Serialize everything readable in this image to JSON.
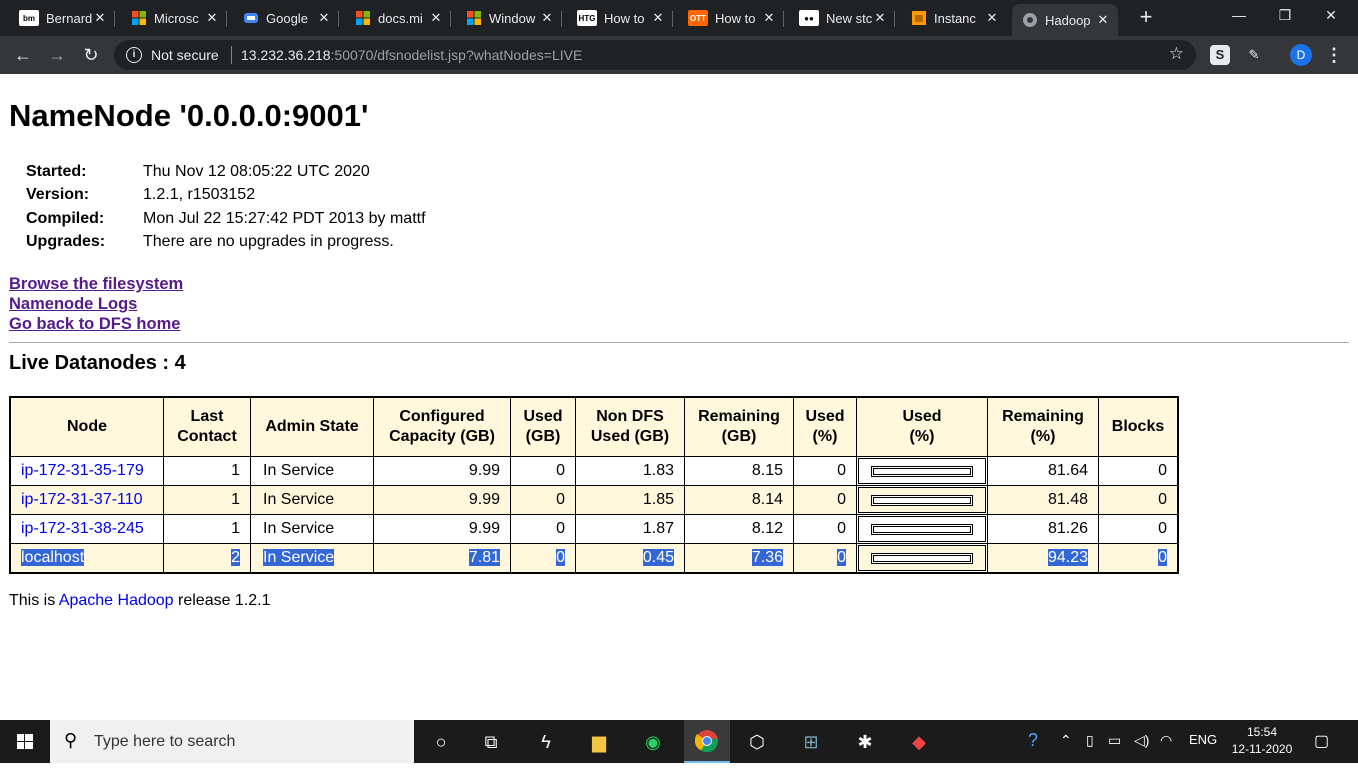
{
  "browser": {
    "tabs": [
      {
        "title": "Bernard",
        "icon": "bm-icon",
        "fav_text": "bm",
        "fav_color": "#ffffff"
      },
      {
        "title": "Microsc",
        "icon": "microsoft-icon",
        "fav_text": "",
        "fav_color": "#f25022"
      },
      {
        "title": "Google",
        "icon": "google-cloud-icon",
        "fav_text": "",
        "fav_color": "#4285f4"
      },
      {
        "title": "docs.mi",
        "icon": "microsoft-icon",
        "fav_text": "",
        "fav_color": "#f25022"
      },
      {
        "title": "Window",
        "icon": "microsoft-icon",
        "fav_text": "",
        "fav_color": "#f25022"
      },
      {
        "title": "How to",
        "icon": "htg-icon",
        "fav_text": "HTG",
        "fav_color": "#000000"
      },
      {
        "title": "How to",
        "icon": "ott-icon",
        "fav_text": "OTT",
        "fav_color": "#ff6600"
      },
      {
        "title": "New stc",
        "icon": "medium-icon",
        "fav_text": "●●",
        "fav_color": "#000000"
      },
      {
        "title": "Instanc",
        "icon": "aws-icon",
        "fav_text": "",
        "fav_color": "#f90"
      },
      {
        "title": "Hadoop",
        "icon": "globe-icon",
        "fav_text": "",
        "fav_color": "#9aa0a6"
      }
    ],
    "new_tab": "+",
    "window_controls": {
      "minimize": "—",
      "restore": "❐",
      "close": "✕"
    },
    "address": {
      "secure_label": "Not secure",
      "host": "13.232.36.218",
      "rest": ":50070/dfsnodelist.jsp?whatNodes=LIVE"
    },
    "profile_initial": "D"
  },
  "page": {
    "title": "NameNode '0.0.0.0:9001'",
    "info": [
      {
        "key": "Started:",
        "value": "Thu Nov 12 08:05:22 UTC 2020"
      },
      {
        "key": "Version:",
        "value": "1.2.1, r1503152"
      },
      {
        "key": "Compiled:",
        "value": "Mon Jul 22 15:27:42 PDT 2013 by mattf"
      },
      {
        "key": "Upgrades:",
        "value": "There are no upgrades in progress."
      }
    ],
    "links": [
      "Browse the filesystem",
      "Namenode Logs",
      "Go back to DFS home"
    ],
    "live_heading": "Live Datanodes : 4",
    "table": {
      "headers": [
        "Node",
        "Last Contact",
        "Admin State",
        "Configured Capacity (GB)",
        "Used (GB)",
        "Non DFS Used (GB)",
        "Remaining (GB)",
        "Used (%)",
        "Used (%)",
        "Remaining (%)",
        "Blocks"
      ],
      "rows": [
        {
          "node": "ip-172-31-35-179",
          "last_contact": "1",
          "admin_state": "In Service",
          "capacity": "9.99",
          "used": "0",
          "non_dfs": "1.83",
          "remaining": "8.15",
          "used_pct": "0",
          "used_bar_fraction": 0,
          "remaining_pct": "81.64",
          "blocks": "0"
        },
        {
          "node": "ip-172-31-37-110",
          "last_contact": "1",
          "admin_state": "In Service",
          "capacity": "9.99",
          "used": "0",
          "non_dfs": "1.85",
          "remaining": "8.14",
          "used_pct": "0",
          "used_bar_fraction": 0,
          "remaining_pct": "81.48",
          "blocks": "0"
        },
        {
          "node": "ip-172-31-38-245",
          "last_contact": "1",
          "admin_state": "In Service",
          "capacity": "9.99",
          "used": "0",
          "non_dfs": "1.87",
          "remaining": "8.12",
          "used_pct": "0",
          "used_bar_fraction": 0,
          "remaining_pct": "81.26",
          "blocks": "0"
        },
        {
          "node": "localhost",
          "last_contact": "2",
          "admin_state": "In Service",
          "capacity": "7.81",
          "used": "0",
          "non_dfs": "0.45",
          "remaining": "7.36",
          "used_pct": "0",
          "used_bar_fraction": 0,
          "remaining_pct": "94.23",
          "blocks": "0"
        }
      ]
    },
    "footer": {
      "prefix": "This is ",
      "link": "Apache Hadoop",
      "suffix": " release 1.2.1"
    }
  },
  "taskbar": {
    "search_placeholder": "Type here to search",
    "language": "ENG",
    "time": "15:54",
    "date": "12-11-2020"
  }
}
